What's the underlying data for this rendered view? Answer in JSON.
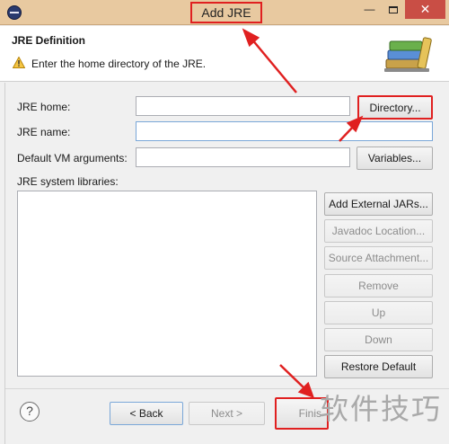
{
  "window": {
    "title": "Add JRE",
    "minimize_glyph": "—",
    "close_glyph": "✕"
  },
  "header": {
    "title": "JRE Definition",
    "message": "Enter the home directory of the JRE.",
    "warning_icon": "warning-icon",
    "banner_icon": "books-icon"
  },
  "form": {
    "jre_home_label": "JRE home:",
    "jre_home_value": "",
    "directory_button": "Directory...",
    "jre_name_label": "JRE name:",
    "jre_name_value": "",
    "vm_args_label": "Default VM arguments:",
    "vm_args_value": "",
    "variables_button": "Variables...",
    "libraries_label": "JRE system libraries:"
  },
  "library_buttons": {
    "add_external": "Add External JARs...",
    "javadoc": "Javadoc Location...",
    "source": "Source Attachment...",
    "remove": "Remove",
    "up": "Up",
    "down": "Down",
    "restore": "Restore Default"
  },
  "footer": {
    "help_glyph": "?",
    "back": "< Back",
    "next": "Next >",
    "finish": "Finis"
  },
  "watermark": "软件技巧",
  "colors": {
    "annotation_red": "#e02020",
    "titlebar": "#e8c9a0",
    "close_button": "#c94e45"
  }
}
